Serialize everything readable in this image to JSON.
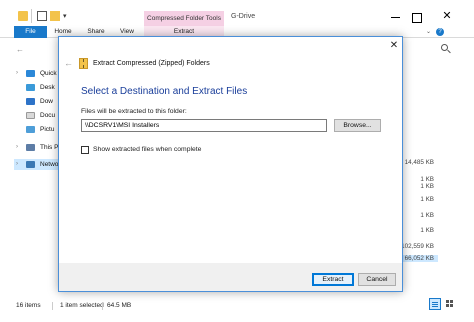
{
  "explorer": {
    "quick_access": {
      "dropdown_glyph": "▾"
    },
    "contextual_tab_title": "Compressed Folder Tools",
    "window_title": "G-Drive",
    "window_controls": {
      "close_glyph": "✕"
    },
    "ribbon_tabs": [
      "File",
      "Home",
      "Share",
      "View",
      "Extract"
    ],
    "help_glyph": "?",
    "ribbon_chevron_glyph": "⌄",
    "back_glyph": "←",
    "nav_items": [
      {
        "label": "Quick",
        "arrow": "›",
        "icon": "star-icon"
      },
      {
        "label": "Desk",
        "arrow": "",
        "icon": "desktop-icon"
      },
      {
        "label": "Dow",
        "arrow": "",
        "icon": "downloads-icon"
      },
      {
        "label": "Docu",
        "arrow": "",
        "icon": "documents-icon"
      },
      {
        "label": "Pictu",
        "arrow": "",
        "icon": "pictures-icon"
      },
      {
        "label": "This P",
        "arrow": "›",
        "icon": "computer-icon"
      },
      {
        "label": "Netwo",
        "arrow": "›",
        "icon": "network-icon"
      }
    ],
    "sizes": [
      "14,485 KB",
      "1 KB",
      "1 KB",
      "1 KB",
      "1 KB",
      "1 KB",
      "102,559 KB",
      "66,052 KB"
    ],
    "resize_glyph": "^",
    "status": {
      "items": "16 items",
      "selected": "1 item selected",
      "size": "64.5 MB"
    }
  },
  "dialog": {
    "close_glyph": "✕",
    "back_glyph": "←",
    "title": "Extract Compressed (Zipped) Folders",
    "heading": "Select a Destination and Extract Files",
    "dest_label": "Files will be extracted to this folder:",
    "dest_value": "\\\\DCSRV1\\MSI Installers",
    "browse_label": "Browse...",
    "show_files_label": "Show extracted files when complete",
    "show_files_checked": false,
    "extract_label": "Extract",
    "cancel_label": "Cancel"
  },
  "colors": {
    "accent": "#1979ca",
    "heading": "#1a3e9a",
    "selection": "#cde8ff",
    "contextual_tab": "#f5d0e4"
  }
}
